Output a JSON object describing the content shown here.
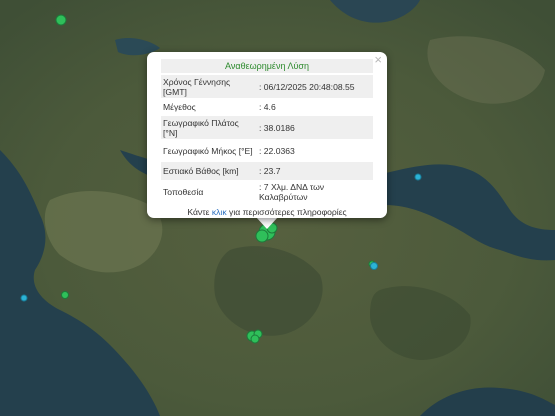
{
  "popup": {
    "title": "Αναθεωρημένη Λύση",
    "close_symbol": "×",
    "rows": [
      {
        "label": "Χρόνος Γέννησης [GMT]",
        "value": ": 06/12/2025 20:48:08.55"
      },
      {
        "label": "Μέγεθος",
        "value": ": 4.6"
      },
      {
        "label": "Γεωγραφικό Πλάτος [°N]",
        "value": ": 38.0186"
      },
      {
        "label": "Γεωγραφικό Μήκος [°E]",
        "value": ": 22.0363"
      },
      {
        "label": "Εστιακό Βάθος [km]",
        "value": ": 23.7"
      },
      {
        "label": "Τοποθεσία",
        "value": ": 7 Χλμ. ΔΝΔ των Καλαβρύτων"
      }
    ],
    "more_prefix": "Κάντε",
    "more_link": "κλικ",
    "more_suffix": "για περισσότερες πληροφορίες"
  },
  "colors": {
    "sea": "#24404d",
    "land": "#4d5c3f",
    "marker_green": "#2fbf5a",
    "marker_cyan": "#2bb3d6",
    "title_green": "#2e8b2e",
    "link_blue": "#2a6fbf"
  }
}
